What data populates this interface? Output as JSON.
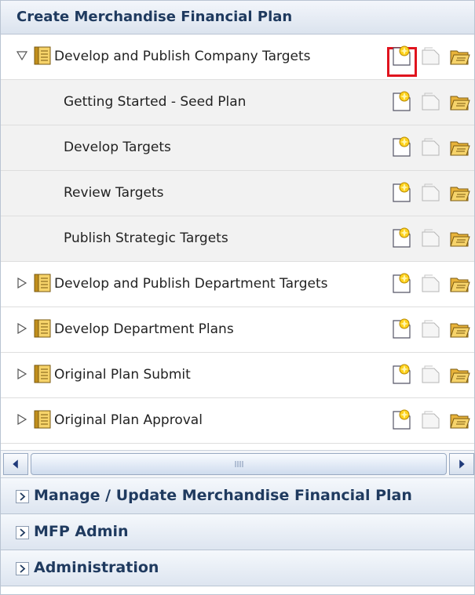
{
  "pane": {
    "title": "Create Merchandise Financial Plan"
  },
  "tasks": [
    {
      "label": "Develop and Publish Company Targets",
      "level": 0,
      "expanded": true,
      "selected_action": "new-icon"
    },
    {
      "label": "Getting Started - Seed Plan",
      "level": 1
    },
    {
      "label": "Develop Targets",
      "level": 1
    },
    {
      "label": "Review Targets",
      "level": 1
    },
    {
      "label": "Publish Strategic Targets",
      "level": 1
    },
    {
      "label": "Develop and Publish Department Targets",
      "level": 0,
      "expanded": false
    },
    {
      "label": "Develop Department Plans",
      "level": 0,
      "expanded": false
    },
    {
      "label": "Original Plan Submit",
      "level": 0,
      "expanded": false
    },
    {
      "label": "Original Plan Approval",
      "level": 0,
      "expanded": false
    }
  ],
  "actions": [
    "new-icon",
    "publish-icon",
    "open-icon"
  ],
  "accordions": [
    {
      "title": "Manage / Update Merchandise Financial Plan"
    },
    {
      "title": "MFP Admin"
    },
    {
      "title": "Administration"
    }
  ],
  "colors": {
    "highlight": "#e0141e",
    "header_text": "#1f3a5f"
  }
}
